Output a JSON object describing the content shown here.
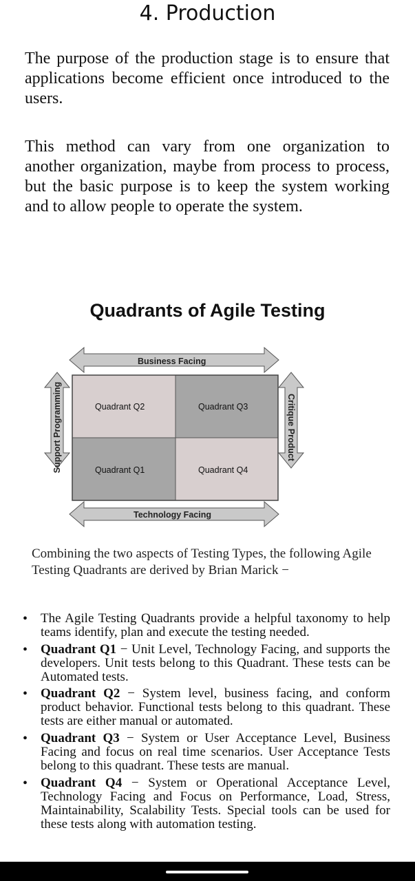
{
  "heading": "4. Production",
  "paragraphs": [
    "The purpose of the production stage is to ensure that applications become efficient once introduced to the users.",
    "This method can vary from one organization to another organization, maybe from process to process, but the basic purpose is to keep the system working and to allow people to operate the system."
  ],
  "diagram": {
    "title": "Quadrants of Agile Testing",
    "top_label": "Business Facing",
    "bottom_label": "Technology Facing",
    "left_label": "Support Programming",
    "right_label": "Critique Product",
    "q2": "Quadrant Q2",
    "q3": "Quadrant Q3",
    "q1": "Quadrant Q1",
    "q4": "Quadrant Q4",
    "colors": {
      "light": "#d8cfcf",
      "dark": "#a6a6a6",
      "arrow": "#c9c9c9",
      "stroke": "#555555"
    }
  },
  "caption": "Combining the two aspects of Testing Types, the following Agile Testing Quadrants are derived by Brian Marick −",
  "bullets": [
    {
      "bold": "",
      "text": "The Agile Testing Quadrants provide a helpful taxonomy to help teams identify, plan and execute the testing needed."
    },
    {
      "bold": "Quadrant Q1",
      "text": " − Unit Level, Technology Facing, and supports the developers. Unit tests belong to this Quadrant. These tests can be Automated tests."
    },
    {
      "bold": "Quadrant Q2",
      "text": " − System level, business facing, and conform product behavior. Functional tests belong to this quadrant. These tests are either manual or automated."
    },
    {
      "bold": "Quadrant Q3",
      "text": " − System or User Acceptance Level, Business Facing and focus on real time scenarios. User Acceptance Tests belong to this quadrant. These tests are manual."
    },
    {
      "bold": "Quadrant Q4",
      "text": " − System or Operational Acceptance Level, Technology Facing and Focus on Performance, Load, Stress, Maintainability, Scalability Tests. Special tools can be used for these tests along with automation testing."
    }
  ]
}
